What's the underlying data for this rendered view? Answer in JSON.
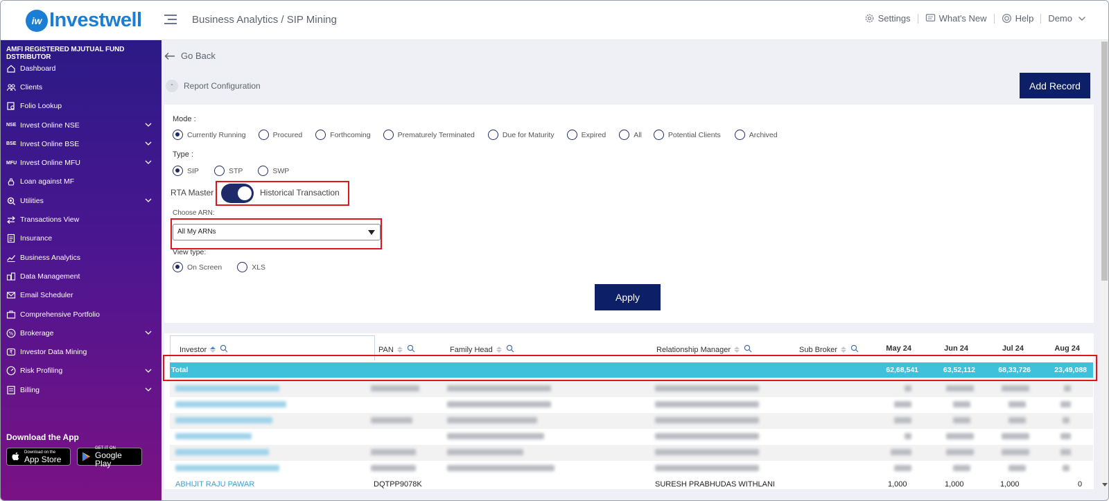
{
  "app": {
    "logo_text": "Investwell",
    "logo_mark": "iw"
  },
  "header": {
    "breadcrumb": "Business Analytics / SIP Mining",
    "settings": "Settings",
    "whats_new": "What's New",
    "help": "Help",
    "user": "Demo"
  },
  "sidebar": {
    "amfi": "AMFI REGISTERED MJUTUAL FUND DSTRIBUTOR",
    "items": [
      {
        "label": "Dashboard",
        "icon": "home-icon"
      },
      {
        "label": "Clients",
        "icon": "users-icon"
      },
      {
        "label": "Folio Lookup",
        "icon": "folio-icon"
      },
      {
        "label": "Invest Online NSE",
        "tag": "NSE",
        "chevron": true
      },
      {
        "label": "Invest Online BSE",
        "tag": "BSE",
        "chevron": true
      },
      {
        "label": "Invest Online MFU",
        "tag": "MFU",
        "chevron": true
      },
      {
        "label": "Loan against MF",
        "icon": "loan-icon"
      },
      {
        "label": "Utilities",
        "icon": "utilities-icon",
        "chevron": true
      },
      {
        "label": "Transactions View",
        "icon": "transfer-icon"
      },
      {
        "label": "Insurance",
        "icon": "document-icon"
      },
      {
        "label": "Business Analytics",
        "icon": "chart-icon"
      },
      {
        "label": "Data Management",
        "icon": "data-icon"
      },
      {
        "label": "Email Scheduler",
        "icon": "mail-icon"
      },
      {
        "label": "Comprehensive Portfolio",
        "icon": "briefcase-icon"
      },
      {
        "label": "Brokerage",
        "icon": "percent-icon",
        "chevron": true
      },
      {
        "label": "Investor Data Mining",
        "icon": "rupee-icon"
      },
      {
        "label": "Risk Profiling",
        "icon": "gauge-icon",
        "chevron": true
      },
      {
        "label": "Billing",
        "icon": "bill-icon",
        "chevron": true
      }
    ],
    "download_title": "Download the App",
    "app_store_small": "Download on the",
    "app_store_big": "App Store",
    "play_small": "GET IT ON",
    "play_big": "Google Play"
  },
  "main": {
    "go_back": "Go Back",
    "report_config": "Report Configuration",
    "add_record": "Add Record",
    "mode_label": "Mode :",
    "modes": [
      "Currently Running",
      "Procured",
      "Forthcoming",
      "Prematurely Terminated",
      "Due for Maturity",
      "Expired",
      "All",
      "Potential Clients",
      "Archived"
    ],
    "mode_selected": "Currently Running",
    "type_label": "Type :",
    "types": [
      "SIP",
      "STP",
      "SWP"
    ],
    "type_selected": "SIP",
    "toggle_left": "RTA Master",
    "toggle_right": "Historical Transaction",
    "toggle_on": true,
    "arn_label": "Choose ARN:",
    "arn_value": "All My ARNs",
    "view_label": "View type:",
    "views": [
      "On Screen",
      "XLS"
    ],
    "view_selected": "On Screen",
    "apply": "Apply"
  },
  "table": {
    "columns": [
      "Investor",
      "PAN",
      "Family Head",
      "Relationship Manager",
      "Sub Broker"
    ],
    "months": [
      "May 24",
      "Jun 24",
      "Jul 24",
      "Aug 24"
    ],
    "total_label": "Total",
    "totals": [
      "62,68,541",
      "63,52,112",
      "68,33,726",
      "23,49,088"
    ],
    "last_row": {
      "investor": "ABHIJIT RAJU PAWAR",
      "pan": "DQTPP9078K",
      "rm": "SURESH PRABHUDAS WITHLANI",
      "values": [
        "1,000",
        "1,000",
        "1,000",
        "0"
      ]
    }
  }
}
